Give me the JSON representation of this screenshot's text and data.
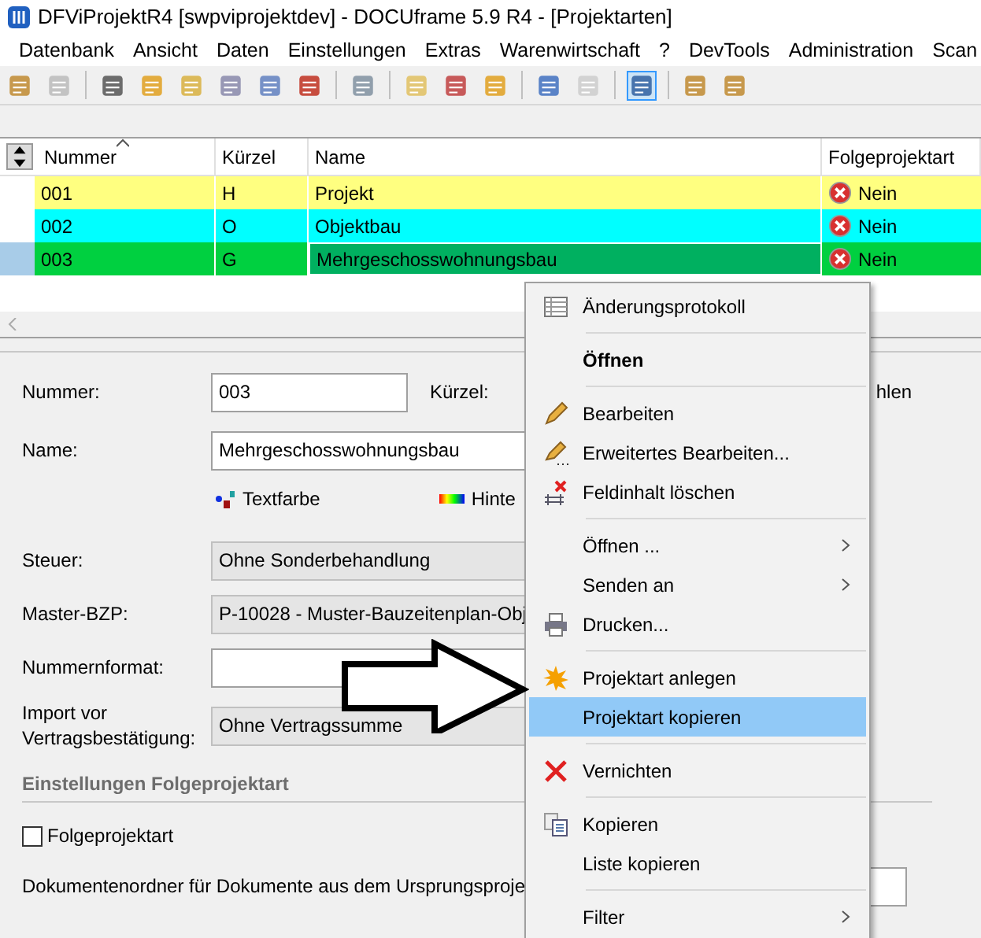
{
  "window": {
    "title": "DFViProjektR4 [swpviprojektdev] - DOCUframe 5.9 R4 - [Projektarten]"
  },
  "menubar": [
    "Datenbank",
    "Ansicht",
    "Daten",
    "Einstellungen",
    "Extras",
    "Warenwirtschaft",
    "?",
    "DevTools",
    "Administration",
    "Scan"
  ],
  "table": {
    "columns": [
      {
        "label": "Nummer",
        "sorted": true
      },
      {
        "label": "Kürzel",
        "sorted": false
      },
      {
        "label": "Name",
        "sorted": false
      },
      {
        "label": "Folgeprojektart",
        "sorted": false
      }
    ],
    "rows": [
      {
        "nummer": "001",
        "kuerzel": "H",
        "name": "Projekt",
        "folgeprojektart": "Nein",
        "color": "#ffff80",
        "selected": false
      },
      {
        "nummer": "002",
        "kuerzel": "O",
        "name": "Objektbau",
        "folgeprojektart": "Nein",
        "color": "#00ffff",
        "selected": false
      },
      {
        "nummer": "003",
        "kuerzel": "G",
        "name": "Mehrgeschosswohnungsbau",
        "folgeprojektart": "Nein",
        "color": "#00d040",
        "selected": true
      }
    ]
  },
  "form": {
    "nummer": {
      "label": "Nummer:",
      "value": "003"
    },
    "kuerzel": {
      "label": "Kürzel:"
    },
    "name": {
      "label": "Name:",
      "value": "Mehrgeschosswohnungsbau"
    },
    "textfarbe": "Textfarbe",
    "hintergrund": "Hinte",
    "cut_text": "hlen",
    "steuer": {
      "label": "Steuer:",
      "value": "Ohne Sonderbehandlung"
    },
    "master_bzp": {
      "label": "Master-BZP:",
      "value": "P-10028 - Muster-Bauzeitenplan-Obj"
    },
    "nummernformat": {
      "label": "Nummernformat:"
    },
    "import": {
      "label": "Import vor\nVertragsbestätigung:",
      "value": "Ohne Vertragssumme"
    },
    "section": "Einstellungen Folgeprojektart",
    "folgeprojektart": {
      "label": "Folgeprojektart",
      "checked": false
    },
    "dokumentenordner": {
      "label": "Dokumentenordner für Dokumente aus dem Ursprungsproje"
    }
  },
  "context_menu": {
    "items": [
      {
        "kind": "item",
        "label": "Änderungsprotokoll",
        "bold": false,
        "submenu": false,
        "selected": false
      },
      {
        "kind": "separator"
      },
      {
        "kind": "item",
        "label": "Öffnen",
        "bold": true,
        "submenu": false,
        "selected": false
      },
      {
        "kind": "separator"
      },
      {
        "kind": "item",
        "label": "Bearbeiten",
        "bold": false,
        "submenu": false,
        "selected": false
      },
      {
        "kind": "item",
        "label": "Erweitertes Bearbeiten...",
        "bold": false,
        "submenu": false,
        "selected": false
      },
      {
        "kind": "item",
        "label": "Feldinhalt löschen",
        "bold": false,
        "submenu": false,
        "selected": false
      },
      {
        "kind": "separator"
      },
      {
        "kind": "item",
        "label": "Öffnen ...",
        "bold": false,
        "submenu": true,
        "selected": false
      },
      {
        "kind": "item",
        "label": "Senden an",
        "bold": false,
        "submenu": true,
        "selected": false
      },
      {
        "kind": "item",
        "label": "Drucken...",
        "bold": false,
        "submenu": false,
        "selected": false
      },
      {
        "kind": "separator"
      },
      {
        "kind": "item",
        "label": "Projektart anlegen",
        "bold": false,
        "submenu": false,
        "selected": false
      },
      {
        "kind": "item",
        "label": "Projektart kopieren",
        "bold": false,
        "submenu": false,
        "selected": true
      },
      {
        "kind": "separator"
      },
      {
        "kind": "item",
        "label": "Vernichten",
        "bold": false,
        "submenu": false,
        "selected": false
      },
      {
        "kind": "separator"
      },
      {
        "kind": "item",
        "label": "Kopieren",
        "bold": false,
        "submenu": false,
        "selected": false
      },
      {
        "kind": "item",
        "label": "Liste kopieren",
        "bold": false,
        "submenu": false,
        "selected": false
      },
      {
        "kind": "separator"
      },
      {
        "kind": "item",
        "label": "Filter",
        "bold": false,
        "submenu": true,
        "selected": false
      }
    ]
  }
}
